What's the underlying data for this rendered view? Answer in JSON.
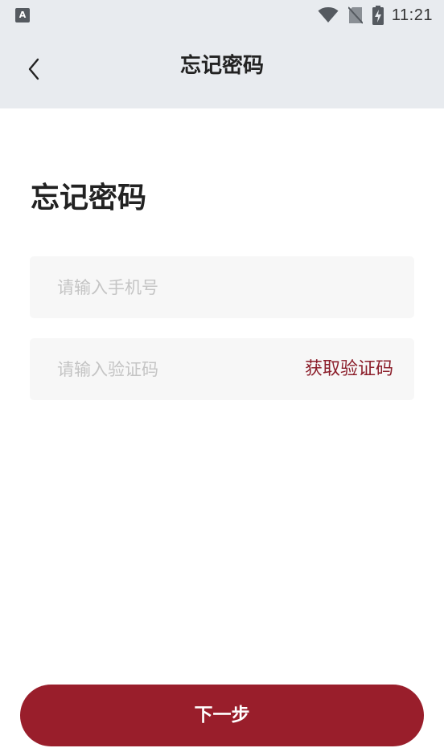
{
  "status_bar": {
    "app_badge": "A",
    "time": "11:21",
    "icons": [
      "wifi-icon",
      "no-sim-icon",
      "battery-charging-icon"
    ]
  },
  "nav": {
    "back_icon": "chevron-left-icon",
    "title": "忘记密码"
  },
  "page": {
    "heading": "忘记密码"
  },
  "form": {
    "phone_placeholder": "请输入手机号",
    "phone_value": "",
    "code_placeholder": "请输入验证码",
    "code_value": "",
    "get_code_label": "获取验证码"
  },
  "actions": {
    "next_label": "下一步"
  },
  "colors": {
    "accent": "#991e2b",
    "link": "#8b1e2a",
    "header_bg": "#e8ebef",
    "field_bg": "#f7f7f7"
  }
}
